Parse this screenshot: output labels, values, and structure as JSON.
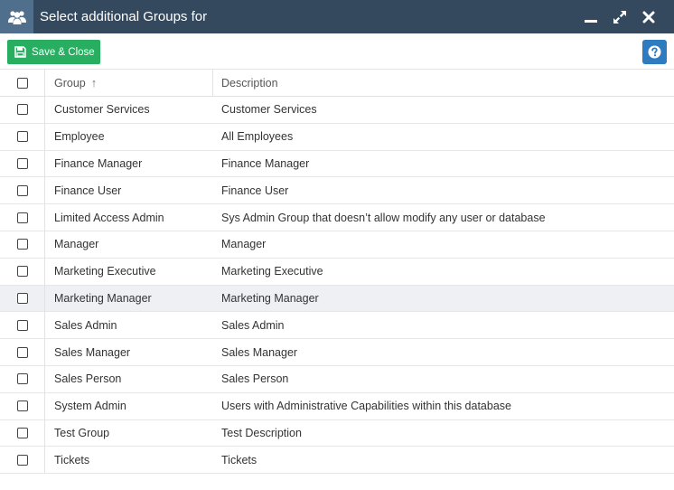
{
  "window": {
    "title": "Select additional Groups for"
  },
  "toolbar": {
    "save_label": "Save & Close"
  },
  "table": {
    "columns": [
      "Group",
      "Description"
    ],
    "sort_indicator": "↑",
    "highlighted_row": 7,
    "rows": [
      {
        "group": "Customer Services",
        "description": "Customer Services"
      },
      {
        "group": "Employee",
        "description": "All Employees"
      },
      {
        "group": "Finance Manager",
        "description": "Finance Manager"
      },
      {
        "group": "Finance User",
        "description": "Finance User"
      },
      {
        "group": "Limited Access Admin",
        "description": "Sys Admin Group that doesn’t allow modify any user or database"
      },
      {
        "group": "Manager",
        "description": "Manager"
      },
      {
        "group": "Marketing Executive",
        "description": "Marketing Executive"
      },
      {
        "group": "Marketing Manager",
        "description": "Marketing Manager"
      },
      {
        "group": "Sales Admin",
        "description": "Sales Admin"
      },
      {
        "group": "Sales Manager",
        "description": "Sales Manager"
      },
      {
        "group": "Sales Person",
        "description": "Sales Person"
      },
      {
        "group": "System Admin",
        "description": "Users with Administrative Capabilities within this database"
      },
      {
        "group": "Test Group",
        "description": "Test Description"
      },
      {
        "group": "Tickets",
        "description": "Tickets"
      }
    ]
  },
  "colors": {
    "titlebar": "#34495e",
    "save_button": "#27ae60",
    "help_button": "#2f7bbf"
  },
  "icons": [
    "users-icon",
    "minimize-icon",
    "maximize-icon",
    "close-icon",
    "save-icon",
    "help-icon"
  ]
}
